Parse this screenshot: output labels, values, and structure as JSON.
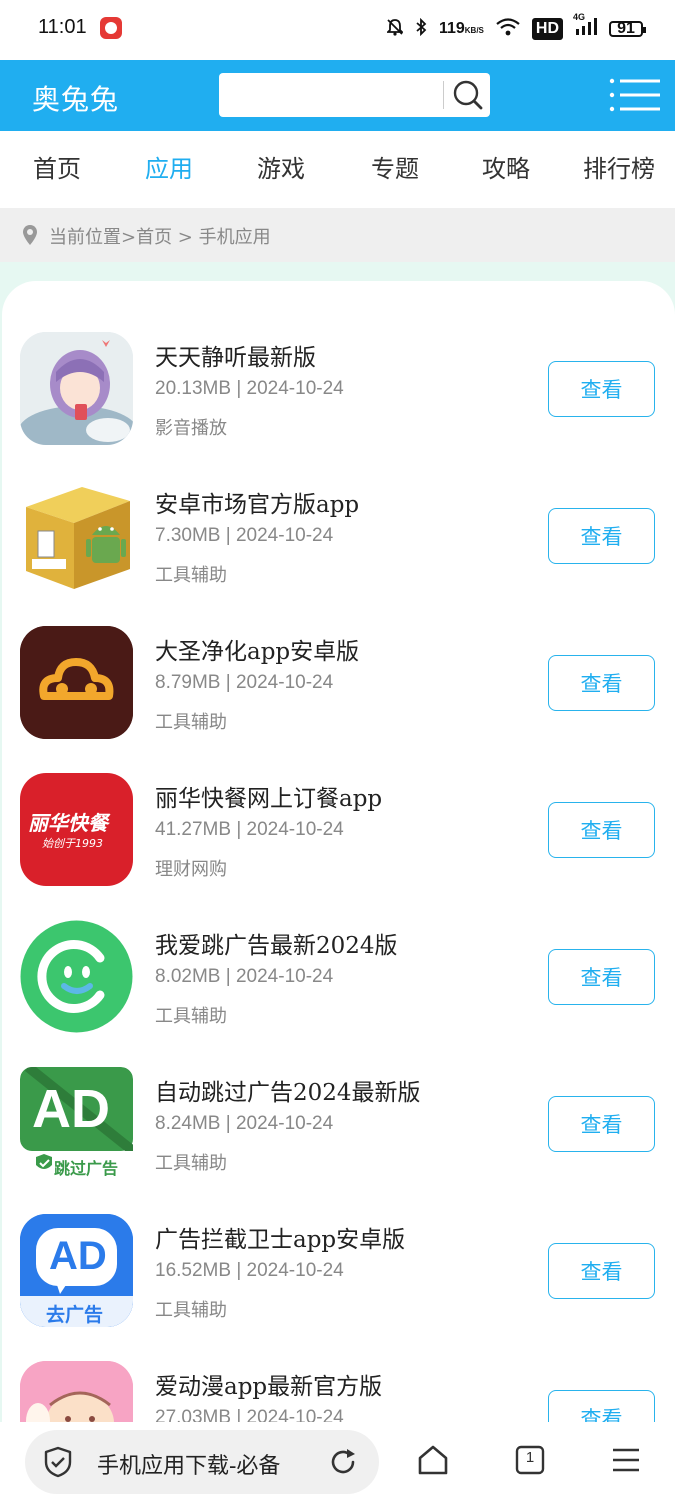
{
  "status": {
    "time": "11:01",
    "speed_value": "119",
    "speed_unit": "KB/S",
    "hd_label": "HD",
    "network": "4G",
    "battery": "91"
  },
  "header": {
    "brand": "奥兔兔",
    "search_placeholder": "",
    "accent_color": "#20aef0"
  },
  "nav": {
    "items": [
      {
        "label": "首页",
        "active": false
      },
      {
        "label": "应用",
        "active": true
      },
      {
        "label": "游戏",
        "active": false
      },
      {
        "label": "专题",
        "active": false
      },
      {
        "label": "攻略",
        "active": false
      },
      {
        "label": "排行榜",
        "active": false
      }
    ]
  },
  "breadcrumb": {
    "text": "当前位置>首页 > 手机应用"
  },
  "apps": [
    {
      "name": "天天静听最新版",
      "meta": "20.13MB | 2024-10-24",
      "category": "影音播放",
      "button": "查看",
      "icon": "anime-girl-icon"
    },
    {
      "name": "安卓市场官方版app",
      "meta": "7.30MB | 2024-10-24",
      "category": "工具辅助",
      "button": "查看",
      "icon": "android-box-icon"
    },
    {
      "name": "大圣净化app安卓版",
      "meta": "8.79MB | 2024-10-24",
      "category": "工具辅助",
      "button": "查看",
      "icon": "cloud-icon"
    },
    {
      "name": "丽华快餐网上订餐app",
      "meta": "41.27MB | 2024-10-24",
      "category": "理财网购",
      "button": "查看",
      "icon": "lihua-logo-icon",
      "icon_text": "丽华快餐",
      "icon_subtext": "始创于1993"
    },
    {
      "name": "我爱跳广告最新2024版",
      "meta": "8.02MB | 2024-10-24",
      "category": "工具辅助",
      "button": "查看",
      "icon": "smiley-icon"
    },
    {
      "name": "自动跳过广告2024最新版",
      "meta": "8.24MB | 2024-10-24",
      "category": "工具辅助",
      "button": "查看",
      "icon": "ad-skip-icon",
      "icon_text": "AD",
      "icon_subtext": "跳过广告"
    },
    {
      "name": "广告拦截卫士app安卓版",
      "meta": "16.52MB | 2024-10-24",
      "category": "工具辅助",
      "button": "查看",
      "icon": "ad-block-icon",
      "icon_text": "AD",
      "icon_subtext": "去广告"
    },
    {
      "name": "爱动漫app最新官方版",
      "meta": "27.03MB | 2024-10-24",
      "category": "",
      "button": "查看",
      "icon": "anime-baby-icon"
    }
  ],
  "bottom_bar": {
    "url_title": "手机应用下载-必备",
    "tab_count": "1"
  }
}
